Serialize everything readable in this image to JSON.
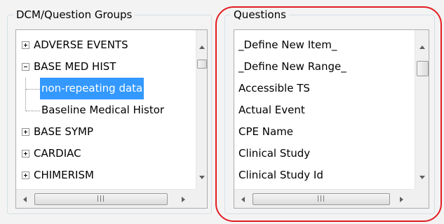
{
  "left_panel": {
    "title": "DCM/Question Groups",
    "tree_items": [
      {
        "label": "ADVERSE EVENTS",
        "expander": "+"
      },
      {
        "label": "BASE MED HIST",
        "expander": "-"
      },
      {
        "label": "non-repeating data",
        "child": true,
        "selected": true
      },
      {
        "label": "Baseline Medical Histor",
        "child": true
      },
      {
        "label": "BASE SYMP",
        "expander": "+"
      },
      {
        "label": "CARDIAC",
        "expander": "+"
      },
      {
        "label": "CHIMERISM",
        "expander": "+"
      }
    ]
  },
  "right_panel": {
    "title": "Questions",
    "items": [
      "_Define New Item_",
      "_Define New Range_",
      "Accessible TS",
      "Actual Event",
      "CPE Name",
      "Clinical Study",
      "Clinical Study Id"
    ]
  },
  "colors": {
    "selection": "#3399ff",
    "highlight_ring": "#e31d22",
    "panel_background": "#f3f3f3"
  }
}
